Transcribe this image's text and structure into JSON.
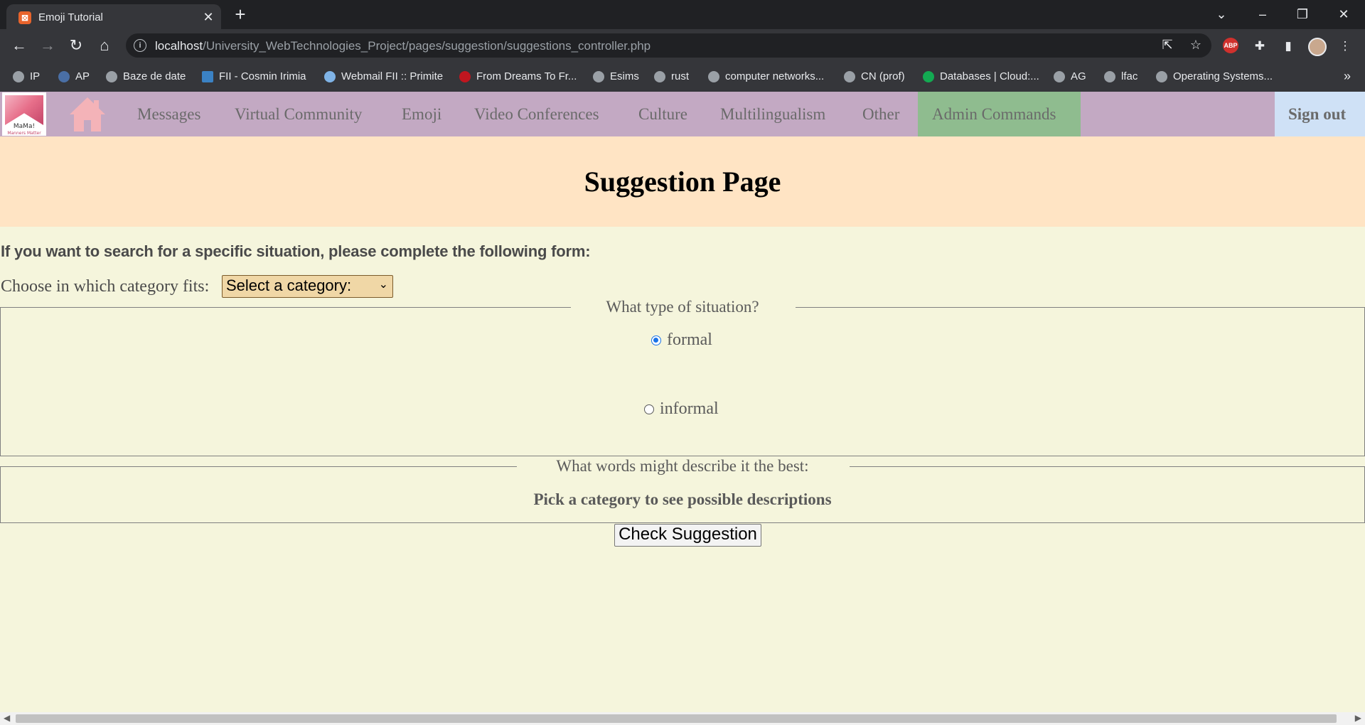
{
  "browser": {
    "tab_title": "Emoji Tutorial",
    "url_host": "localhost",
    "url_path": "/University_WebTechnologies_Project/pages/suggestion/suggestions_controller.php",
    "bookmarks": [
      {
        "label": "IP"
      },
      {
        "label": "AP"
      },
      {
        "label": "Baze de date"
      },
      {
        "label": "FII - Cosmin Irimia"
      },
      {
        "label": "Webmail FII :: Primite"
      },
      {
        "label": "From Dreams To Fr..."
      },
      {
        "label": "Esims"
      },
      {
        "label": "rust"
      },
      {
        "label": "computer networks..."
      },
      {
        "label": "CN (prof)"
      },
      {
        "label": "Databases | Cloud:..."
      },
      {
        "label": "AG"
      },
      {
        "label": "lfac"
      },
      {
        "label": "Operating Systems..."
      }
    ]
  },
  "site": {
    "logo_text": "MaMa!",
    "logo_subtext": "Manners Matter",
    "nav": [
      {
        "label": "Messages"
      },
      {
        "label": "Virtual Community"
      },
      {
        "label": "Emoji"
      },
      {
        "label": "Video Conferences"
      },
      {
        "label": "Culture"
      },
      {
        "label": "Multilingualism"
      },
      {
        "label": "Other"
      },
      {
        "label": "Admin Commands"
      }
    ],
    "sign_out": "Sign out",
    "colors": {
      "navbar": "#c3a9c3",
      "admin": "#8fbc8f",
      "signout": "#cfe1f6",
      "header": "#ffe4c4",
      "page_bg": "#f5f5dc"
    }
  },
  "page": {
    "title": "Suggestion Page",
    "intro": "If you want to search for a specific situation, please complete the following form:",
    "category_label": "Choose in which category fits:",
    "category_selected": "Select a category:",
    "situation_legend": "What type of situation?",
    "situation_options": [
      {
        "label": "formal",
        "checked": true
      },
      {
        "label": "informal",
        "checked": false
      }
    ],
    "words_legend": "What words might describe it the best:",
    "words_hint": "Pick a category to see possible descriptions",
    "submit_label": "Check Suggestion"
  }
}
